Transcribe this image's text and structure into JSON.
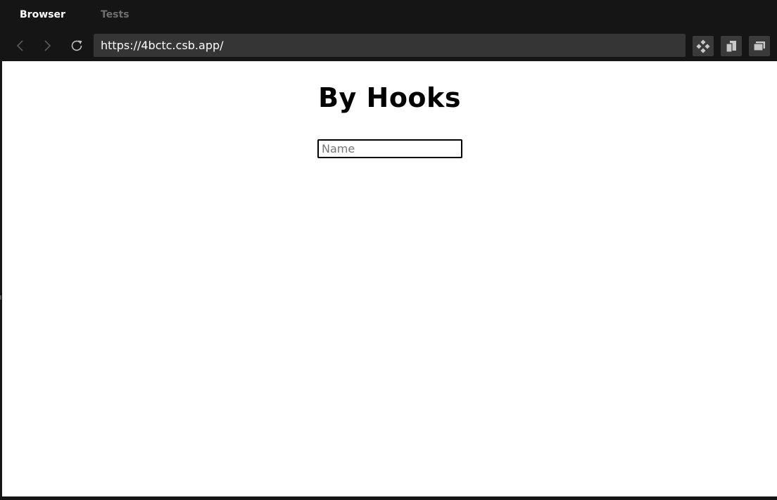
{
  "tabs": [
    {
      "label": "Browser",
      "active": true
    },
    {
      "label": "Tests",
      "active": false
    }
  ],
  "toolbar": {
    "url": "https://4bctc.csb.app/",
    "back_icon": "chevron-left-icon",
    "forward_icon": "chevron-right-icon",
    "reload_icon": "reload-icon",
    "tool_icons": [
      "devtools-icon",
      "responsive-icon",
      "new-window-icon"
    ]
  },
  "page": {
    "title": "By Hooks",
    "name_input": {
      "placeholder": "Name",
      "value": ""
    }
  },
  "colors": {
    "chrome_bg": "#151515",
    "url_bg": "#353535",
    "active_tab": "#ffffff",
    "inactive_tab": "#6f6f6f",
    "accent_green": "#2e8b2e"
  }
}
